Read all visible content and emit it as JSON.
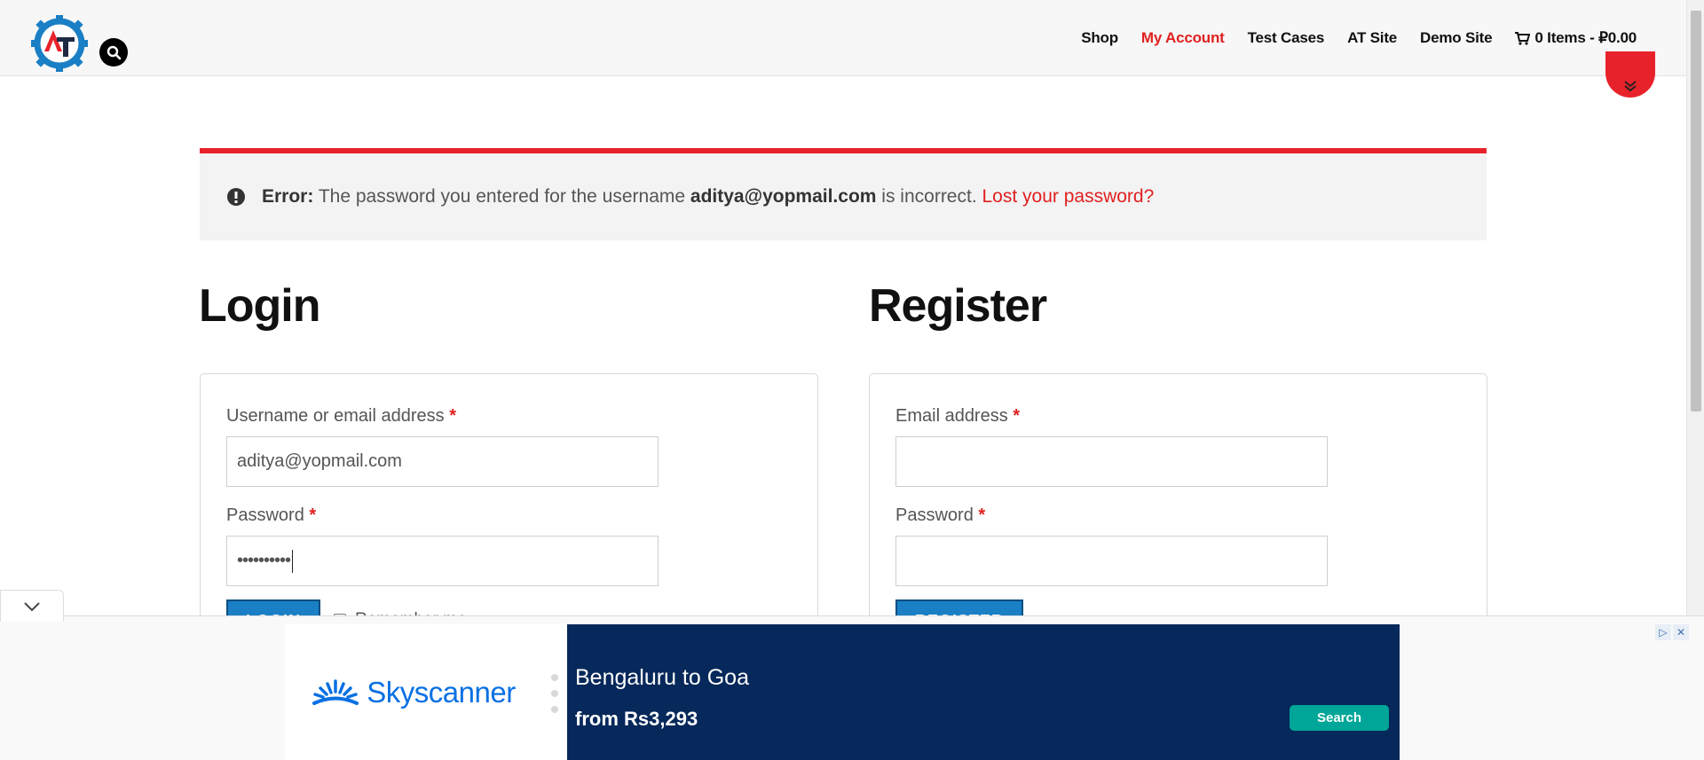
{
  "nav": {
    "items": [
      {
        "label": "Shop",
        "active": false
      },
      {
        "label": "My Account",
        "active": true
      },
      {
        "label": "Test Cases",
        "active": false
      },
      {
        "label": "AT Site",
        "active": false
      },
      {
        "label": "Demo Site",
        "active": false
      }
    ],
    "cart_label": "0 Items - ₽0.00"
  },
  "notice": {
    "prefix": "Error:",
    "text_before": "The password you entered for the username",
    "username": "aditya@yopmail.com",
    "text_after": "is incorrect.",
    "link": "Lost your password?"
  },
  "login": {
    "heading": "Login",
    "username_label": "Username or email address",
    "username_value": "aditya@yopmail.com",
    "password_label": "Password",
    "password_value": "••••••••••",
    "button_label": "LOGIN",
    "remember_label": "Remember me",
    "required_mark": "*"
  },
  "register": {
    "heading": "Register",
    "email_label": "Email address",
    "password_label": "Password",
    "button_label": "REGISTER",
    "required_mark": "*"
  },
  "ad": {
    "brand": "Skyscanner",
    "title": "Bengaluru to Goa",
    "price": "from Rs3,293",
    "cta": "Search"
  },
  "colors": {
    "accent_red": "#e8222a",
    "button_blue": "#1a7fc4",
    "ad_navy": "#06285a",
    "ad_teal": "#00a698"
  }
}
